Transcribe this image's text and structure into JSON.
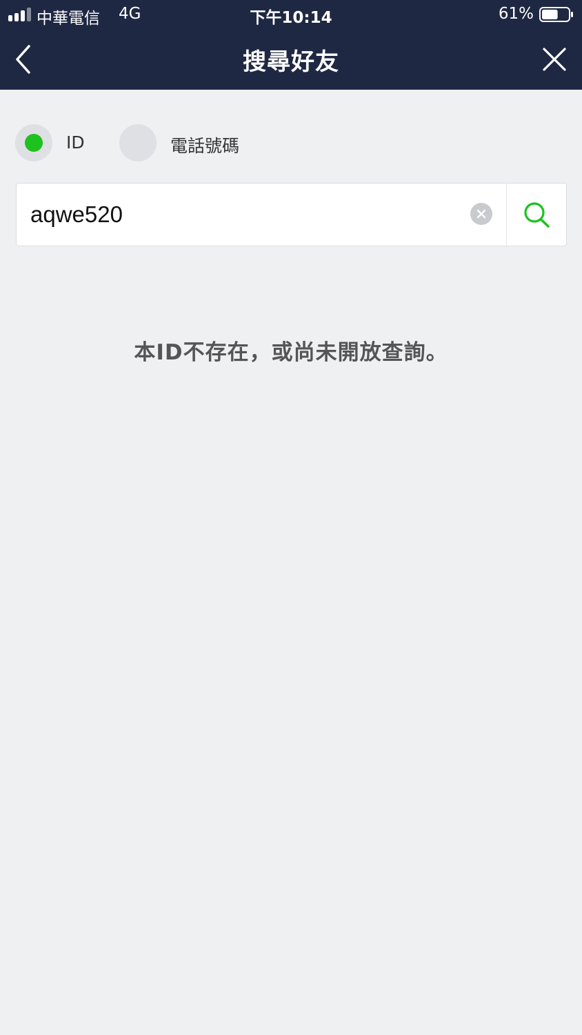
{
  "status_bar": {
    "carrier": "中華電信",
    "network": "4G",
    "time": "下午10:14",
    "battery": "61%",
    "battery_level": 0.61
  },
  "nav": {
    "title": "搜尋好友",
    "back_icon": "chevron-left-icon",
    "close_icon": "close-icon"
  },
  "search_type": {
    "selected": "ID",
    "options": [
      {
        "label": "ID"
      },
      {
        "label": "電話號碼"
      }
    ]
  },
  "search": {
    "value": "aqwe520",
    "clear_icon": "clear-icon",
    "search_icon": "search-icon"
  },
  "result": {
    "message": "本ID不存在，或尚未開放查詢。"
  },
  "colors": {
    "header_bg": "#1f2843",
    "page_bg": "#eff0f2",
    "accent_green": "#1ec21e"
  }
}
